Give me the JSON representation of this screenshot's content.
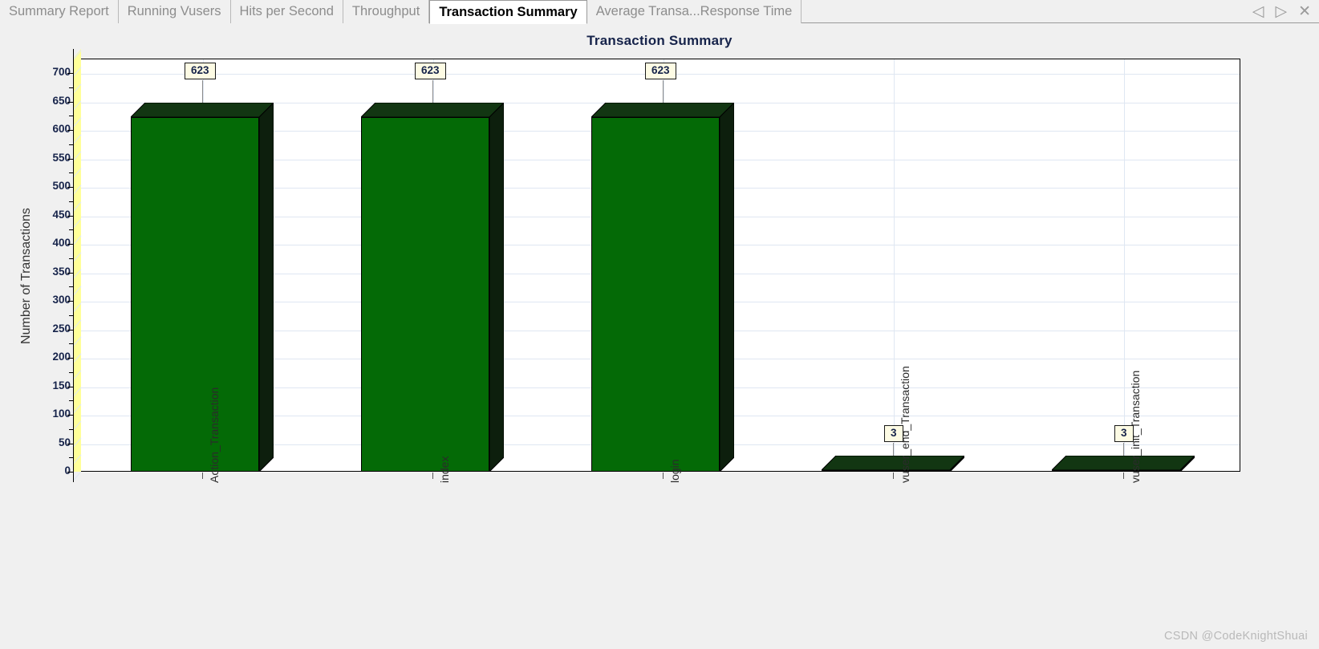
{
  "window": {
    "tabs": [
      {
        "label": "Summary Report",
        "active": false
      },
      {
        "label": "Running Vusers",
        "active": false
      },
      {
        "label": "Hits per Second",
        "active": false
      },
      {
        "label": "Throughput",
        "active": false
      },
      {
        "label": "Transaction Summary",
        "active": true
      },
      {
        "label": "Average Transa...Response Time",
        "active": false
      }
    ],
    "controls": {
      "scroll_left": "◁",
      "scroll_right": "▷",
      "close": "✕"
    }
  },
  "watermark": "CSDN @CodeKnightShuai",
  "chart_data": {
    "type": "bar",
    "title": "Transaction Summary",
    "xlabel": "",
    "ylabel": "Number of Transactions",
    "categories": [
      "Action_Transaction",
      "index",
      "login",
      "vuser_end_Transaction",
      "vuser_init_Transaction"
    ],
    "values": [
      623,
      623,
      623,
      3,
      3
    ],
    "data_labels": [
      "623",
      "623",
      "623",
      "3",
      "3"
    ],
    "ylim": [
      0,
      700
    ],
    "ytick_labels": [
      "700",
      "650",
      "600",
      "550",
      "500",
      "450",
      "400",
      "350",
      "300",
      "250",
      "200",
      "150",
      "100",
      "50",
      "0"
    ],
    "ytick_values": [
      700,
      650,
      600,
      550,
      500,
      450,
      400,
      350,
      300,
      250,
      200,
      150,
      100,
      50,
      0
    ],
    "grid": true,
    "legend": "none",
    "bar_color": "#046a06",
    "bar_side_color": "#0d1f0d",
    "plot_background": "#ffffff",
    "wall_color": "#ffff99",
    "label_box_color": "#fdfbe4"
  }
}
